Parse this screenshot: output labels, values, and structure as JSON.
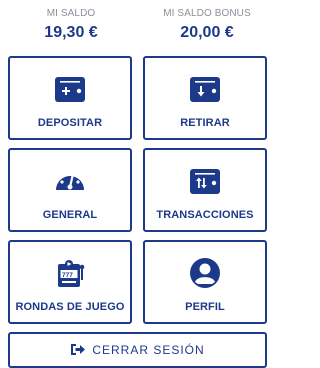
{
  "balances": {
    "main_label": "MI SALDO",
    "main_value": "19,30 €",
    "bonus_label": "MI SALDO BONUS",
    "bonus_value": "20,00 €"
  },
  "tiles": [
    {
      "label": "DEPOSITAR",
      "icon": "wallet-plus-icon"
    },
    {
      "label": "RETIRAR",
      "icon": "wallet-arrow-down-icon"
    },
    {
      "label": "GENERAL",
      "icon": "gauge-icon"
    },
    {
      "label": "TRANSACCIONES",
      "icon": "wallet-transfer-icon"
    },
    {
      "label": "RONDAS DE JUEGO",
      "icon": "slot-machine-icon"
    },
    {
      "label": "PERFIL",
      "icon": "user-icon"
    }
  ],
  "logout": {
    "label": "CERRAR SESIÓN",
    "icon": "sign-out-icon"
  },
  "colors": {
    "primary": "#1d3a8a",
    "muted": "#8a8f99",
    "background": "#ffffff"
  }
}
